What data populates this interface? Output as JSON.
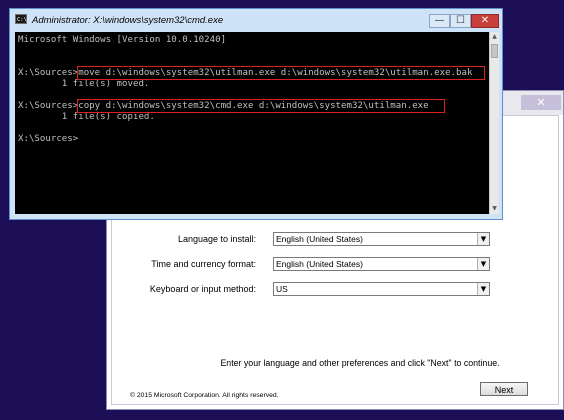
{
  "cmd_window": {
    "icon_label": "C:\\",
    "title": "Administrator: X:\\windows\\system32\\cmd.exe",
    "min_symbol": "—",
    "max_symbol": "☐",
    "close_symbol": "✕",
    "lines": [
      "Microsoft Windows [Version 10.0.10240]",
      "",
      "X:\\Sources>move d:\\windows\\system32\\utilman.exe d:\\windows\\system32\\utilman.exe.bak",
      "        1 file(s) moved.",
      "",
      "X:\\Sources>copy d:\\windows\\system32\\cmd.exe d:\\windows\\system32\\utilman.exe",
      "        1 file(s) copied.",
      "",
      "X:\\Sources>"
    ],
    "scroll_up": "▲",
    "scroll_down": "▼"
  },
  "setup_window": {
    "close_symbol": "✕",
    "fields": [
      {
        "label": "Language to install:",
        "value": "English (United States)"
      },
      {
        "label": "Time and currency format:",
        "value": "English (United States)"
      },
      {
        "label": "Keyboard or input method:",
        "value": "US"
      }
    ],
    "dropdown_arrow": "▼",
    "hint": "Enter your language and other preferences and click \"Next\" to continue.",
    "copyright": "© 2015 Microsoft Corporation. All rights reserved.",
    "next_label": "Next"
  },
  "colors": {
    "desktop": "#1c0f57",
    "highlight_box": "#e0201a",
    "console_text": "#c0c0c0"
  }
}
